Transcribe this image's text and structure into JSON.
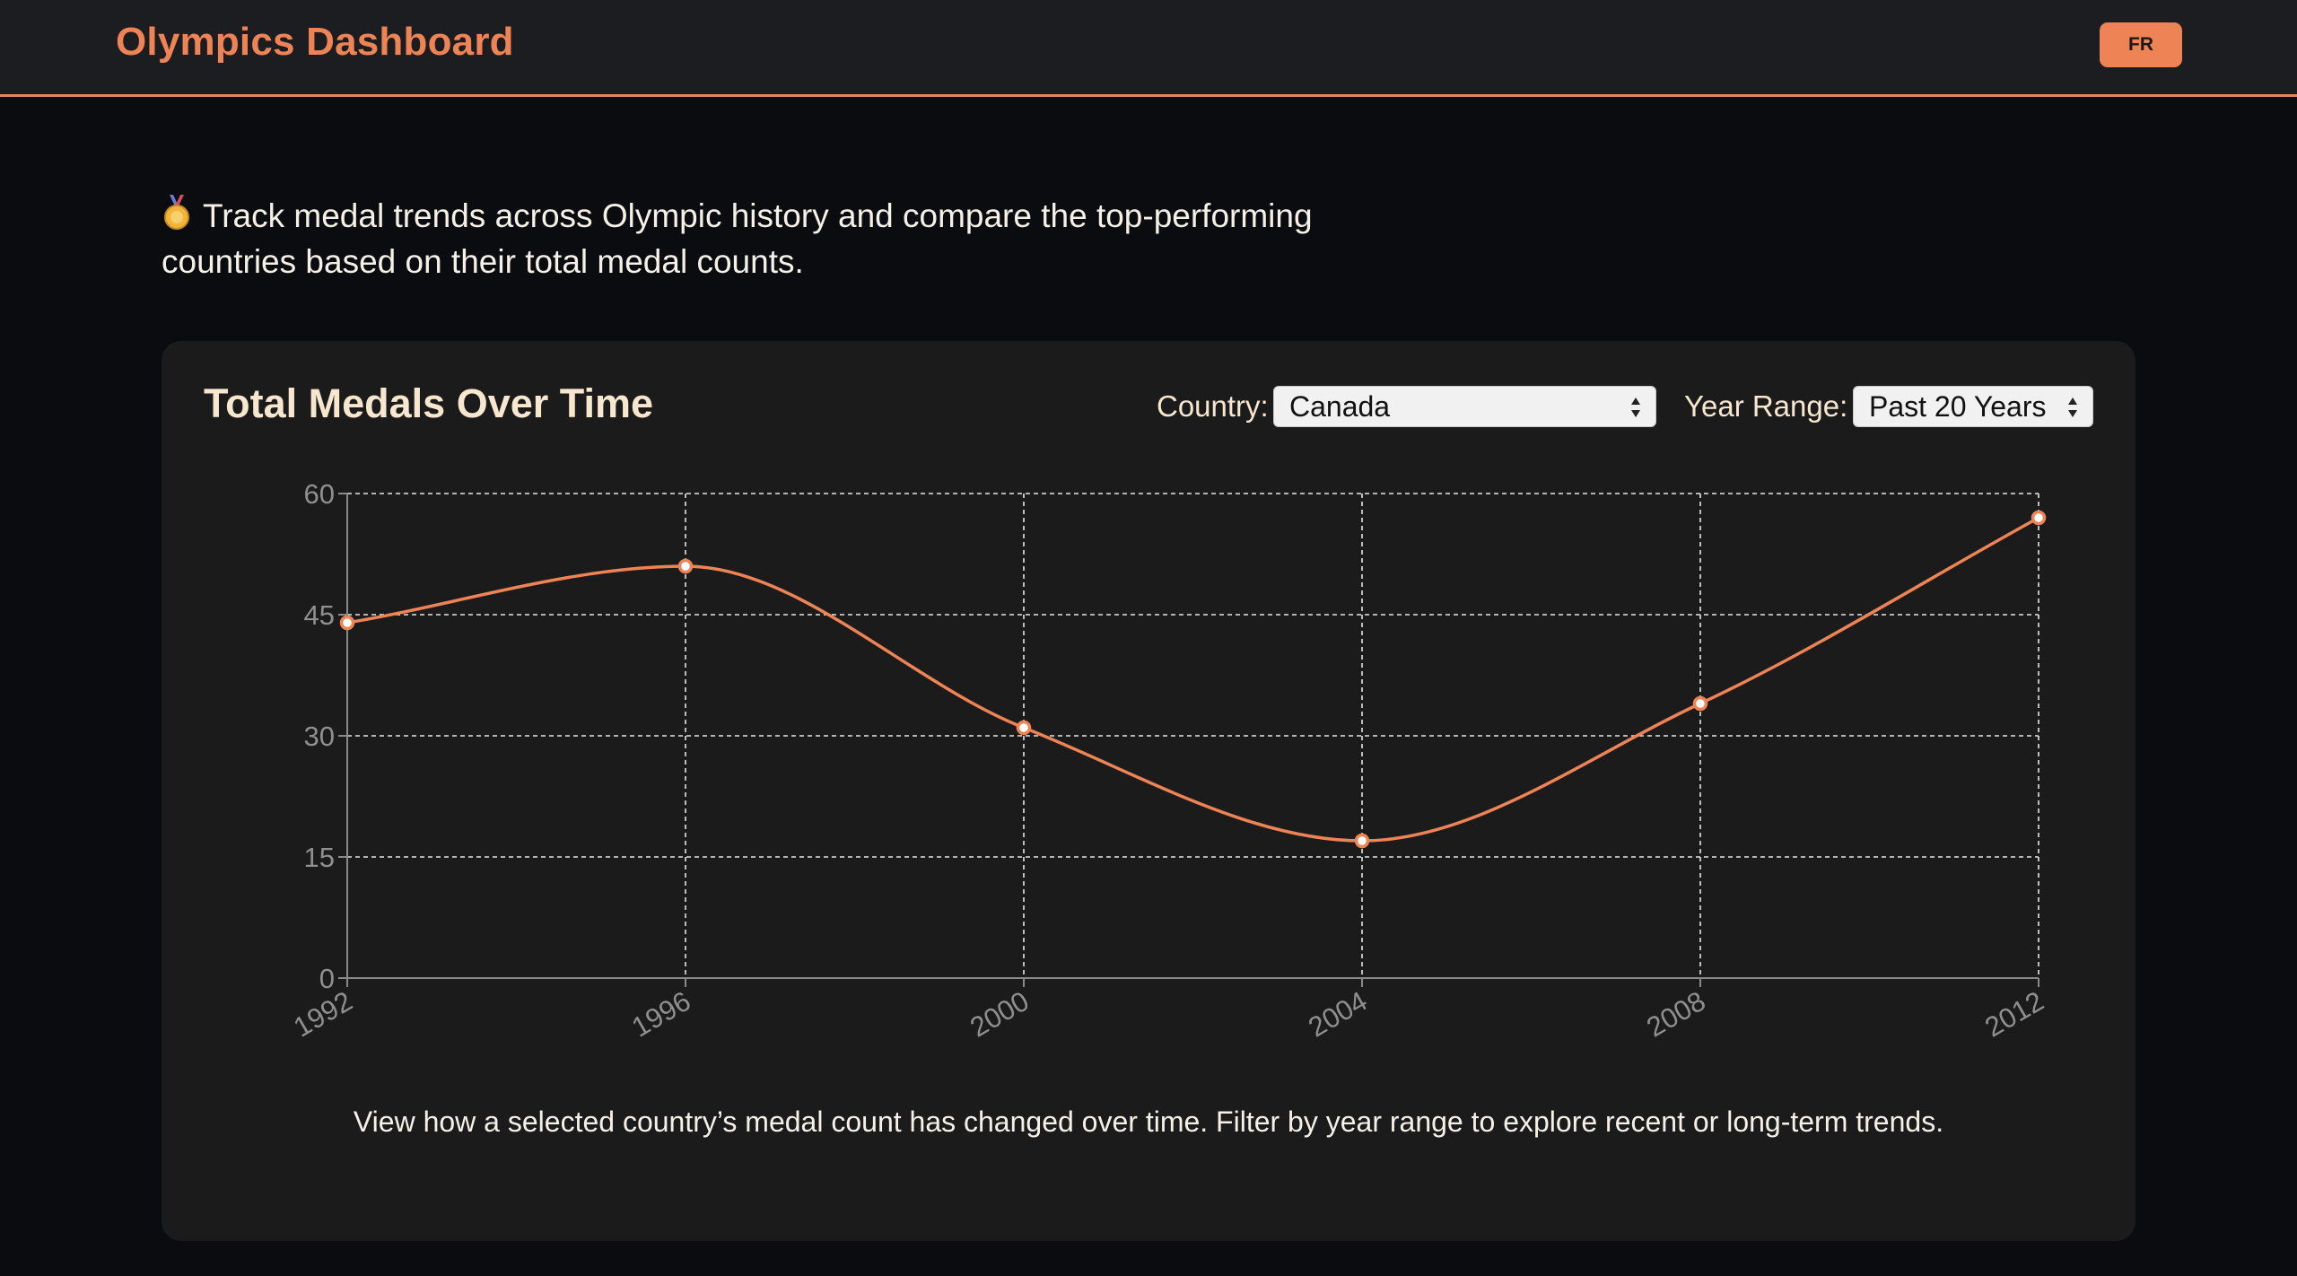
{
  "header": {
    "title": "Olympics Dashboard",
    "language_button": "FR"
  },
  "intro": {
    "icon": "medal-icon",
    "text": "Track medal trends across Olympic history and compare the top-performing countries based on their total medal counts."
  },
  "panel": {
    "title": "Total Medals Over Time",
    "country_label": "Country:",
    "country_value": "Canada",
    "year_range_label": "Year Range:",
    "year_range_value": "Past 20 Years",
    "caption": "View how a selected country’s medal count has changed over time. Filter by year range to explore recent or long-term trends."
  },
  "colors": {
    "accent": "#ee8455",
    "background": "#0b0c0f",
    "panel": "#1b1b1c",
    "header": "#1c1d21",
    "text_light": "#f7e7cf"
  },
  "chart_data": {
    "type": "line",
    "x": [
      "1992",
      "1996",
      "2000",
      "2004",
      "2008",
      "2012"
    ],
    "series": [
      {
        "values": [
          44,
          51,
          31,
          17,
          34,
          57
        ]
      }
    ],
    "yticks": [
      0,
      15,
      30,
      45,
      60
    ],
    "ylim": [
      0,
      60
    ],
    "title": "",
    "xlabel": "",
    "ylabel": "",
    "grid": true,
    "curve": "smooth"
  }
}
